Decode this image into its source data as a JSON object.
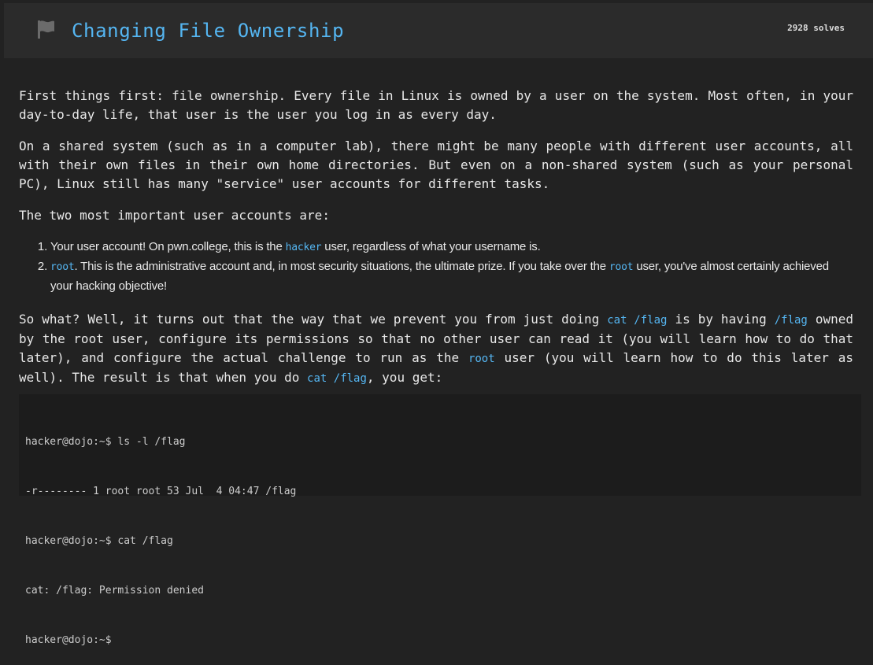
{
  "header": {
    "title": "Changing File Ownership",
    "solves": "2928 solves",
    "icon": "flag-icon"
  },
  "content": {
    "p1": "First things first: file ownership. Every file in Linux is owned by a user on the system. Most often, in your day-to-day life, that user is the user you log in as every day.",
    "p2": "On a shared system (such as in a computer lab), there might be many people with different user accounts, all with their own files in their own home directories. But even on a non-shared system (such as your personal PC), Linux still has many \"service\" user accounts for different tasks.",
    "p3": "The two most important user accounts are:",
    "list": [
      {
        "pre": "Your user account! On pwn.college, this is the ",
        "code": "hacker",
        "post": " user, regardless of what your username is."
      },
      {
        "code1": "root",
        "mid": ". This is the administrative account and, in most security situations, the ultimate prize. If you take over the ",
        "code2": "root",
        "post": " user, you've almost certainly achieved your hacking objective!"
      }
    ],
    "p4": {
      "t1": "So what? Well, it turns out that the way that we prevent you from just doing ",
      "c1": "cat /flag",
      "t2": " is by having ",
      "c2": "/flag",
      "t3": " owned by the root user, configure its permissions so that no other user can read it (you will learn how to do that later), and configure the actual challenge to run as the ",
      "c3": "root",
      "t4": " user (you will learn how to do this later as well). The result is that when you do ",
      "c4": "cat /flag",
      "t5": ", you get:"
    }
  },
  "terminal": {
    "lines": [
      "hacker@dojo:~$ ls -l /flag",
      "-r-------- 1 root root 53 Jul  4 04:47 /flag",
      "hacker@dojo:~$ cat /flag",
      "cat: /flag: Permission denied",
      "hacker@dojo:~$"
    ]
  },
  "colors": {
    "accent": "#55b6f2",
    "background": "#222222",
    "header_bg": "#2b2b2b",
    "terminal_bg": "#1c1c1c"
  }
}
